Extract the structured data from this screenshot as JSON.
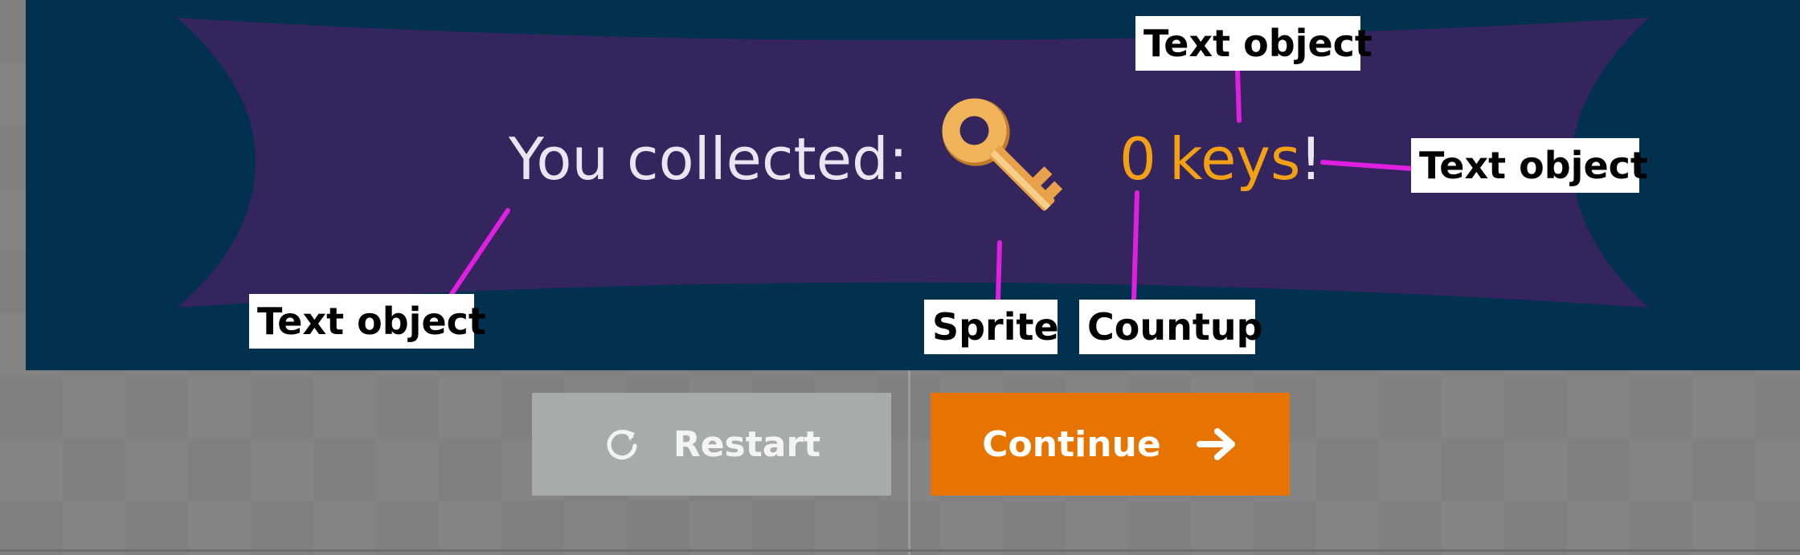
{
  "scene": {
    "message": "You collected:",
    "count": "0",
    "count_suffix": "keys",
    "exclamation": "!",
    "sprite_icon": "key-icon",
    "colors": {
      "background": "#023150",
      "banner": "#34255e",
      "message_text": "#e9e6f2",
      "count_text": "#f3a014",
      "key": "#f0b35a"
    }
  },
  "buttons": {
    "restart_label": "Restart",
    "restart_icon": "restart-icon",
    "continue_label": "Continue",
    "continue_icon": "arrow-right-icon",
    "colors": {
      "restart": "#a7acaa",
      "continue": "#e87400"
    }
  },
  "annotations": {
    "keys_label": "Text object",
    "exclamation_label": "Text object",
    "message_label": "Text object",
    "sprite_label": "Sprite",
    "countup_label": "Countup",
    "leader_color": "#e020e0"
  }
}
